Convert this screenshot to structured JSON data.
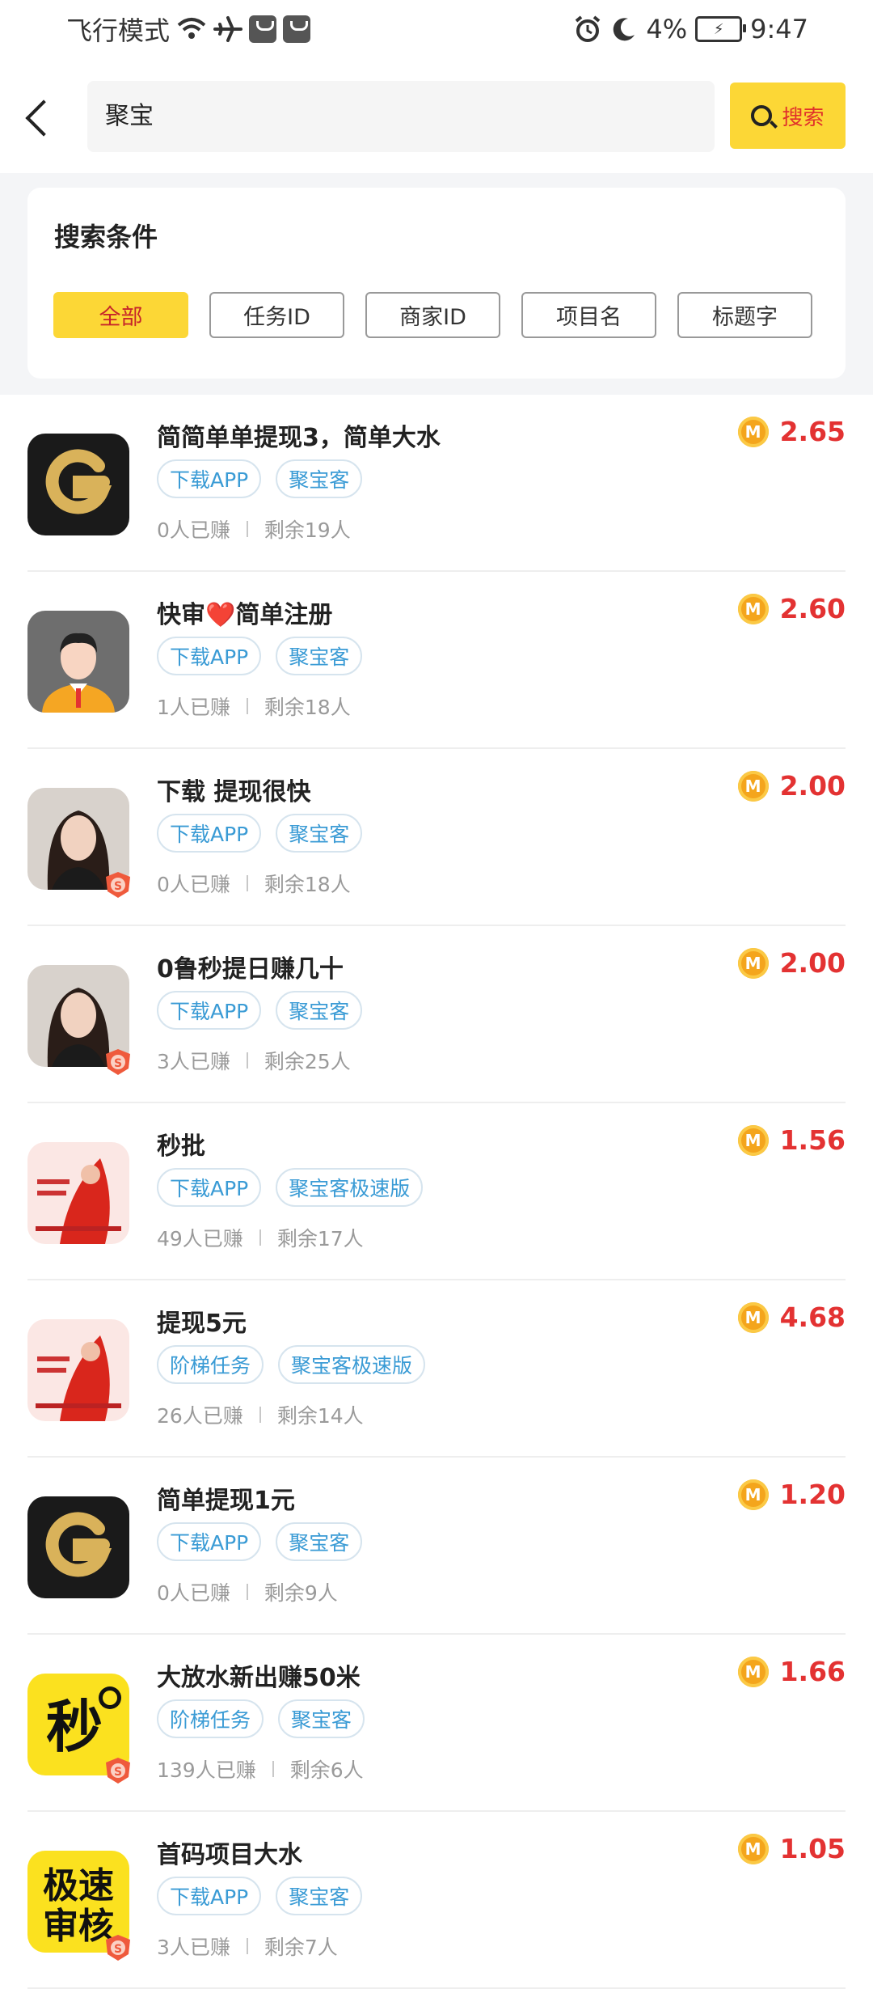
{
  "status_bar": {
    "left_text": "飞行模式",
    "battery": "4%",
    "time": "9:47"
  },
  "header": {
    "search_value": "聚宝",
    "search_button": "搜索"
  },
  "filter": {
    "title": "搜索条件",
    "chips": [
      "全部",
      "任务ID",
      "商家ID",
      "项目名",
      "标题字"
    ],
    "active_index": 0
  },
  "colors": {
    "accent_yellow": "#fcd736",
    "price_red": "#e33232",
    "tag_blue": "#3a9bd5",
    "coin_orange": "#f4a51c"
  },
  "items": [
    {
      "title": "简简单单提现3，简单大水",
      "tags": [
        "下载APP",
        "聚宝客"
      ],
      "earned": "0人已赚",
      "remaining": "剩余19人",
      "price": "2.65",
      "icon": "g-logo-icon",
      "badge": false
    },
    {
      "title": "快审❤️简单注册",
      "tags": [
        "下载APP",
        "聚宝客"
      ],
      "earned": "1人已赚",
      "remaining": "剩余18人",
      "price": "2.60",
      "icon": "avatar-man-icon",
      "badge": false
    },
    {
      "title": "下载 提现很快",
      "tags": [
        "下载APP",
        "聚宝客"
      ],
      "earned": "0人已赚",
      "remaining": "剩余18人",
      "price": "2.00",
      "icon": "avatar-woman-photo",
      "badge": true
    },
    {
      "title": "0鲁秒提日赚几十",
      "tags": [
        "下载APP",
        "聚宝客"
      ],
      "earned": "3人已赚",
      "remaining": "剩余25人",
      "price": "2.00",
      "icon": "avatar-woman-photo",
      "badge": true
    },
    {
      "title": "秒批",
      "tags": [
        "下载APP",
        "聚宝客极速版"
      ],
      "earned": "49人已赚",
      "remaining": "剩余17人",
      "price": "1.56",
      "icon": "red-poster-icon",
      "badge": false
    },
    {
      "title": "提现5元",
      "tags": [
        "阶梯任务",
        "聚宝客极速版"
      ],
      "earned": "26人已赚",
      "remaining": "剩余14人",
      "price": "4.68",
      "icon": "red-poster-icon",
      "badge": false
    },
    {
      "title": "简单提现1元",
      "tags": [
        "下载APP",
        "聚宝客"
      ],
      "earned": "0人已赚",
      "remaining": "剩余9人",
      "price": "1.20",
      "icon": "g-logo-icon",
      "badge": false
    },
    {
      "title": "大放水新出赚50米",
      "tags": [
        "阶梯任务",
        "聚宝客"
      ],
      "earned": "139人已赚",
      "remaining": "剩余6人",
      "price": "1.66",
      "icon": "miao-logo-icon",
      "badge": true
    },
    {
      "title": "首码项目大水",
      "tags": [
        "下载APP",
        "聚宝客"
      ],
      "earned": "3人已赚",
      "remaining": "剩余7人",
      "price": "1.05",
      "icon": "jisu-logo-icon",
      "badge": true
    }
  ]
}
